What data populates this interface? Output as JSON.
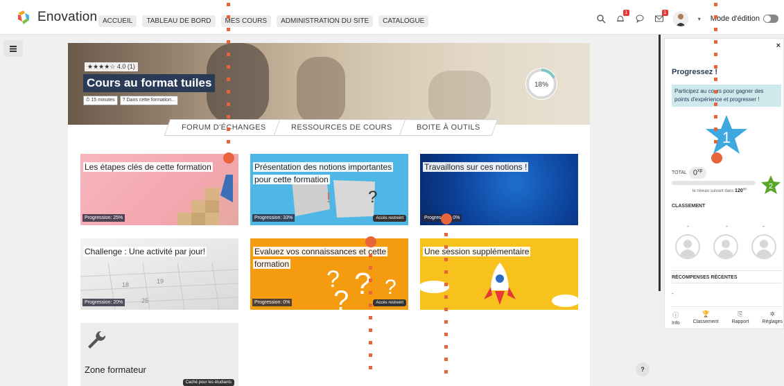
{
  "header": {
    "brand": "Enovation",
    "nav": [
      "ACCUEIL",
      "TABLEAU DE BORD",
      "MES COURS",
      "ADMINISTRATION DU SITE",
      "CATALOGUE"
    ],
    "notif_badge": "1",
    "msg_badge": "1",
    "edit_mode_label": "Mode d'édition"
  },
  "course": {
    "rating": "★★★★☆ 4.0 (1)",
    "title": "Cours au format tuiles",
    "duration": "⏱ 15 minutes",
    "tag": "? Dans cette formation...",
    "progress": "18%",
    "progress_value": 18
  },
  "tabs": [
    "FORUM D'ÉCHANGES",
    "RESSOURCES DE COURS",
    "BOITE À OUTILS"
  ],
  "tiles": [
    {
      "title": "Les étapes clés de cette formation",
      "progress": "Progression: 25%",
      "restricted": ""
    },
    {
      "title": "Présentation des notions importantes pour cette formation",
      "progress": "Progression: 33%",
      "restricted": "Accès restreint"
    },
    {
      "title": "Travaillons sur ces notions !",
      "progress": "Progression: 0%",
      "restricted": ""
    },
    {
      "title": "Challenge : Une activité par jour!",
      "progress": "Progression: 20%",
      "restricted": ""
    },
    {
      "title": "Evaluez vos connaissances et cette formation",
      "progress": "Progression: 0%",
      "restricted": "Accès restreint"
    },
    {
      "title": "Une session supplémentaire",
      "progress": "",
      "restricted": ""
    }
  ],
  "zone": {
    "title": "Zone formateur",
    "badge": "Caché pour les étudiants"
  },
  "help": "?",
  "panel": {
    "close": "×",
    "title": "Progressez !",
    "info": "Participez au cours pour gagner des points d'expérience et progresser !",
    "level": "1",
    "total_label": "TOTAL",
    "xp": "0",
    "xp_unit": "xp",
    "next_label": "le niveau suivant dans",
    "next_value": "120",
    "next_level": "2",
    "ranking_label": "CLASSEMENT",
    "ranking_dashes": [
      "-",
      "-",
      "-"
    ],
    "rewards_label": "RÉCOMPENSES RÉCENTES",
    "rewards_value": "-",
    "footer": [
      {
        "icon": "info-icon",
        "glyph": "ⓘ",
        "label": "Info"
      },
      {
        "icon": "trophy-icon",
        "glyph": "🏆",
        "label": "Classement"
      },
      {
        "icon": "report-icon",
        "glyph": "⎘",
        "label": "Rapport"
      },
      {
        "icon": "gear-icon",
        "glyph": "✲",
        "label": "Réglages"
      }
    ]
  },
  "colors": {
    "accent": "#2b3a57",
    "ring": "#7fc7c2",
    "highlight": "#e8653c",
    "level_star": "#3ea8e0",
    "level2_star": "#5aa62b"
  }
}
